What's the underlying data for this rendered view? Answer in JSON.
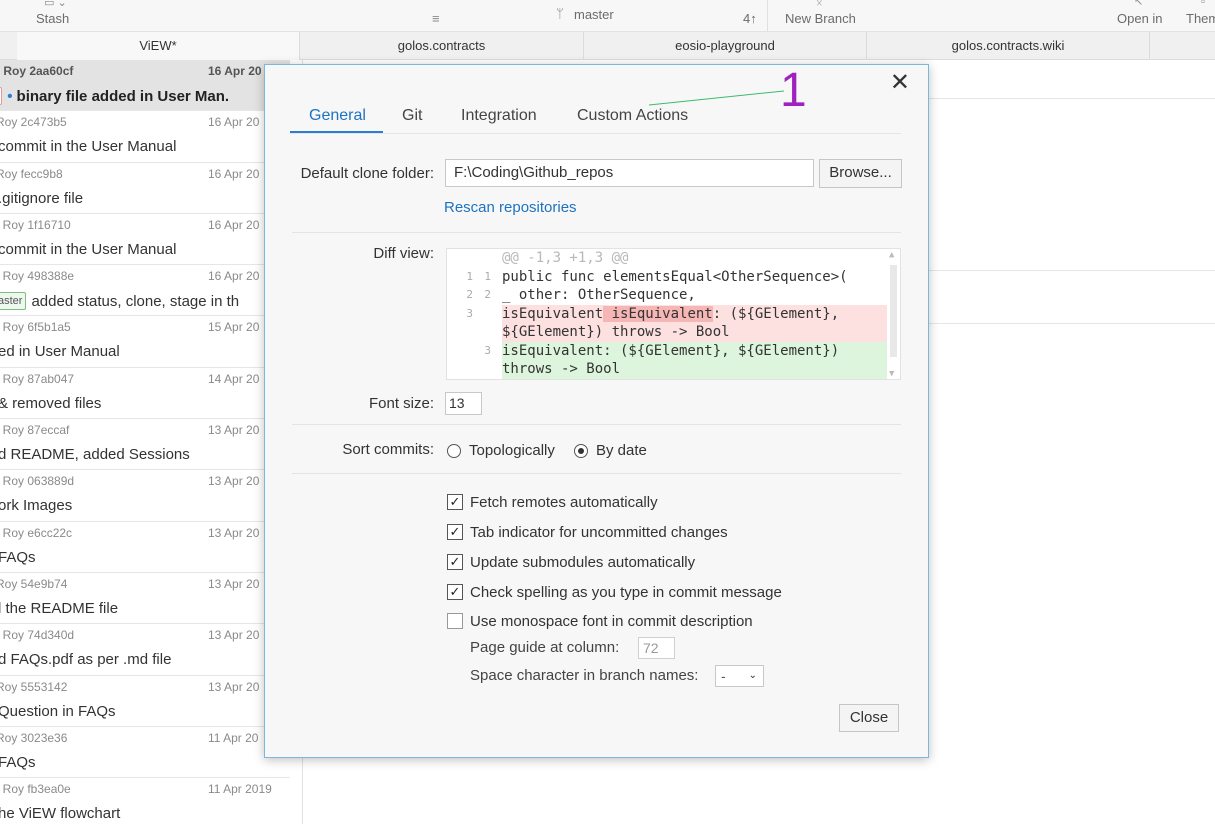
{
  "toolbar": {
    "stash_label": "Stash",
    "branch_label": "master",
    "ahead_label": "4↑",
    "new_branch_label": "New Branch",
    "open_in_label": "Open in",
    "theme_label": "Them"
  },
  "tabs": [
    "ViEW*",
    "golos.contracts",
    "eosio-playground",
    "golos.contracts.wiki"
  ],
  "commits": [
    {
      "meta": "t Roy  2aa60cf",
      "date": "16 Apr 20",
      "badge": "r",
      "dot": "•",
      "msg": "binary file added in User Man."
    },
    {
      "meta": "Roy  2c473b5",
      "date": "16 Apr 20",
      "msg": "commit in the User Manual"
    },
    {
      "meta": "Roy  fecc9b8",
      "date": "16 Apr 20",
      "msg": ".gitignore file"
    },
    {
      "meta": "t Roy  1f16710",
      "date": "16 Apr 20",
      "msg": "commit in the User Manual"
    },
    {
      "meta": "t Roy  498388e",
      "date": "16 Apr 20",
      "badge": "aster",
      "msg": "added status, clone, stage in th"
    },
    {
      "meta": "t Roy  6f5b1a5",
      "date": "15 Apr 20",
      "msg": "ed in User Manual"
    },
    {
      "meta": "t Roy  87ab047",
      "date": "14 Apr 20",
      "msg": "& removed files"
    },
    {
      "meta": "t Roy  87eccaf",
      "date": "13 Apr 20",
      "msg": "d README, added Sessions"
    },
    {
      "meta": "t Roy  063889d",
      "date": "13 Apr 20",
      "msg": "ork Images"
    },
    {
      "meta": "t Roy  e6cc22c",
      "date": "13 Apr 20",
      "msg": "FAQs"
    },
    {
      "meta": "Roy  54e9b74",
      "date": "13 Apr 20",
      "msg": "l the README file"
    },
    {
      "meta": "t Roy  74d340d",
      "date": "13 Apr 20",
      "msg": "d FAQs.pdf as per .md file"
    },
    {
      "meta": "Roy  5553142",
      "date": "13 Apr 20",
      "msg": "Question in FAQs"
    },
    {
      "meta": "Roy  3023e36",
      "date": "11 Apr 20",
      "msg": "FAQs"
    },
    {
      "meta": "t Roy  fb3ea0e",
      "date": "11 Apr 2019",
      "msg": "he ViEW flowchart"
    }
  ],
  "dialog": {
    "tabs": [
      "General",
      "Git",
      "Integration",
      "Custom Actions"
    ],
    "annotation": "1",
    "clone_folder_label": "Default clone folder:",
    "clone_folder_value": "F:\\Coding\\Github_repos",
    "browse_label": "Browse...",
    "rescan_label": "Rescan repositories",
    "diff_view_label": "Diff view:",
    "diff_lines": [
      {
        "n1": "",
        "n2": "",
        "type": "hdr",
        "code": "@@ -1,3 +1,3 @@"
      },
      {
        "n1": "1",
        "n2": "1",
        "type": "ctx",
        "code": "public func elementsEqual<OtherSequence>("
      },
      {
        "n1": "2",
        "n2": "2",
        "type": "ctx",
        "code": "_ other: OtherSequence,"
      },
      {
        "n1": "3",
        "n2": "",
        "type": "del",
        "pre": "isEquivalent",
        "hl": " isEquivalent",
        "post": ": (${GElement},"
      },
      {
        "n1": "",
        "n2": "",
        "type": "del",
        "code": "${GElement}) throws -> Bool"
      },
      {
        "n1": "",
        "n2": "3",
        "type": "add",
        "code": "isEquivalent: (${GElement}, ${GElement})"
      },
      {
        "n1": "",
        "n2": "",
        "type": "add",
        "code": "throws -> Bool"
      }
    ],
    "font_size_label": "Font size:",
    "font_size_value": "13",
    "sort_label": "Sort commits:",
    "sort_options": [
      "Topologically",
      "By date"
    ],
    "checkboxes": [
      {
        "label": "Fetch remotes automatically",
        "checked": true
      },
      {
        "label": "Tab indicator for uncommitted changes",
        "checked": true
      },
      {
        "label": "Update submodules automatically",
        "checked": true
      },
      {
        "label": "Check spelling as you type in commit message",
        "checked": true
      },
      {
        "label": "Use monospace font in commit description",
        "checked": false
      }
    ],
    "page_guide_label": "Page guide at column:",
    "page_guide_value": "72",
    "space_char_label": "Space character in branch names:",
    "space_char_value": "-",
    "close_label": "Close"
  },
  "colors": {
    "accent": "#2a7fd4",
    "annotation": "#a020c0",
    "diff_del": "#fde0e0",
    "diff_add": "#dcf5dc"
  }
}
